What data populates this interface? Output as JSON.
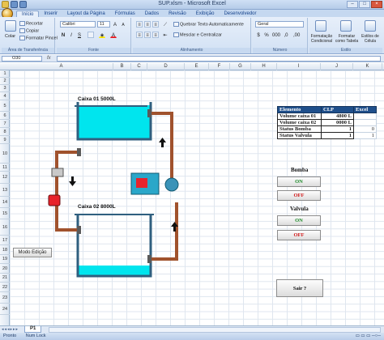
{
  "window": {
    "title": "SUP.xlsm - Microsoft Excel"
  },
  "ribbon": {
    "tabs": [
      "Início",
      "Inserir",
      "Layout da Página",
      "Fórmulas",
      "Dados",
      "Revisão",
      "Exibição",
      "Desenvolvedor"
    ],
    "active_tab": "Início",
    "clipboard": {
      "paste_label": "Colar",
      "cut_label": "Recortar",
      "copy_label": "Copiar",
      "format_painter_label": "Formatar Pincel",
      "group_title": "Área de Transferência"
    },
    "font": {
      "font_name": "Calibri",
      "font_size": "11",
      "group_title": "Fonte"
    },
    "alignment": {
      "wrap_label": "Quebrar Texto Automaticamente",
      "merge_label": "Mesclar e Centralizar",
      "group_title": "Alinhamento"
    },
    "number": {
      "format_value": "Geral",
      "group_title": "Número"
    },
    "styles": {
      "conditional_label": "Formatação Condicional",
      "table_label": "Formatar como Tabela",
      "cell_styles_label": "Estilos de Célula",
      "group_title": "Estilo"
    }
  },
  "formula_bar": {
    "name_box": "O30",
    "fx": "fx",
    "formula": ""
  },
  "columns": [
    "A",
    "B",
    "C",
    "D",
    "E",
    "F",
    "G",
    "H",
    "I",
    "J",
    "K"
  ],
  "rows": [
    "1",
    "2",
    "3",
    "4",
    "5",
    "6",
    "7",
    "8",
    "9",
    "10",
    "11",
    "12",
    "13",
    "14",
    "15",
    "16",
    "17",
    "18",
    "19",
    "20",
    "21",
    "22",
    "23",
    "24"
  ],
  "drawing": {
    "tank1_label": "Caixa 01 5000L",
    "tank2_label": "Caixa 02 8000L",
    "colors": {
      "water": "#00e5ee",
      "pipe": "#a0522d",
      "tank_wall": "#2f5f7f",
      "pump_body": "#2aa7c9",
      "pump_motor": "#e8232b"
    }
  },
  "table": {
    "headers": [
      "Elemento",
      "CLP",
      "Excel"
    ],
    "rows": [
      {
        "label": "Volume caixa 01",
        "clp": "4800 L",
        "excel": ""
      },
      {
        "label": "Volume caixa 02",
        "clp": "0000 L",
        "excel": ""
      },
      {
        "label": "Status Bomba",
        "clp": "1",
        "excel": "0"
      },
      {
        "label": "Status Valvula",
        "clp": "1",
        "excel": "1"
      }
    ]
  },
  "controls": {
    "bomba_title": "Bomba",
    "valvula_title": "Valvula",
    "on_label": "ON",
    "off_label": "OFF",
    "exit_label": "Sair ?",
    "edit_mode_label": "Modo Edição"
  },
  "sheets": {
    "active": "P1"
  },
  "status": {
    "ready": "Pronto",
    "num_lock": "Num Lock"
  }
}
